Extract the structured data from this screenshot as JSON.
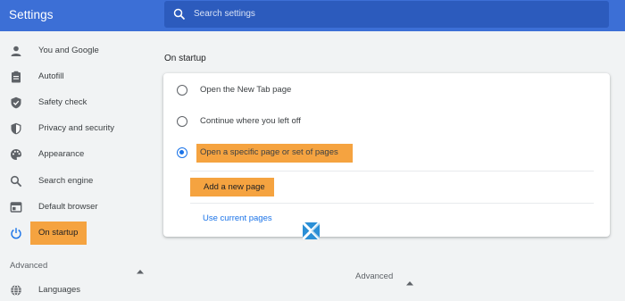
{
  "header": {
    "title": "Settings",
    "search_placeholder": "Search settings"
  },
  "sidebar": {
    "items": [
      {
        "label": "You and Google",
        "icon": "person-icon"
      },
      {
        "label": "Autofill",
        "icon": "clipboard-icon"
      },
      {
        "label": "Safety check",
        "icon": "shield-check-icon"
      },
      {
        "label": "Privacy and security",
        "icon": "shield-icon"
      },
      {
        "label": "Appearance",
        "icon": "palette-icon"
      },
      {
        "label": "Search engine",
        "icon": "search-icon"
      },
      {
        "label": "Default browser",
        "icon": "browser-icon"
      },
      {
        "label": "On startup",
        "icon": "power-icon",
        "active": true
      },
      {
        "label": "Languages",
        "icon": "globe-icon"
      }
    ],
    "advanced_label": "Advanced"
  },
  "main": {
    "section_title": "On startup",
    "options": [
      {
        "label": "Open the New Tab page",
        "checked": false
      },
      {
        "label": "Continue where you left off",
        "checked": false
      },
      {
        "label": "Open a specific page or set of pages",
        "checked": true
      }
    ],
    "add_page_label": "Add a new page",
    "use_current_label": "Use current pages",
    "advanced_label": "Advanced"
  },
  "colors": {
    "header": "#3c6fd6",
    "highlight": "#f5a340",
    "accent": "#1a73e8"
  }
}
